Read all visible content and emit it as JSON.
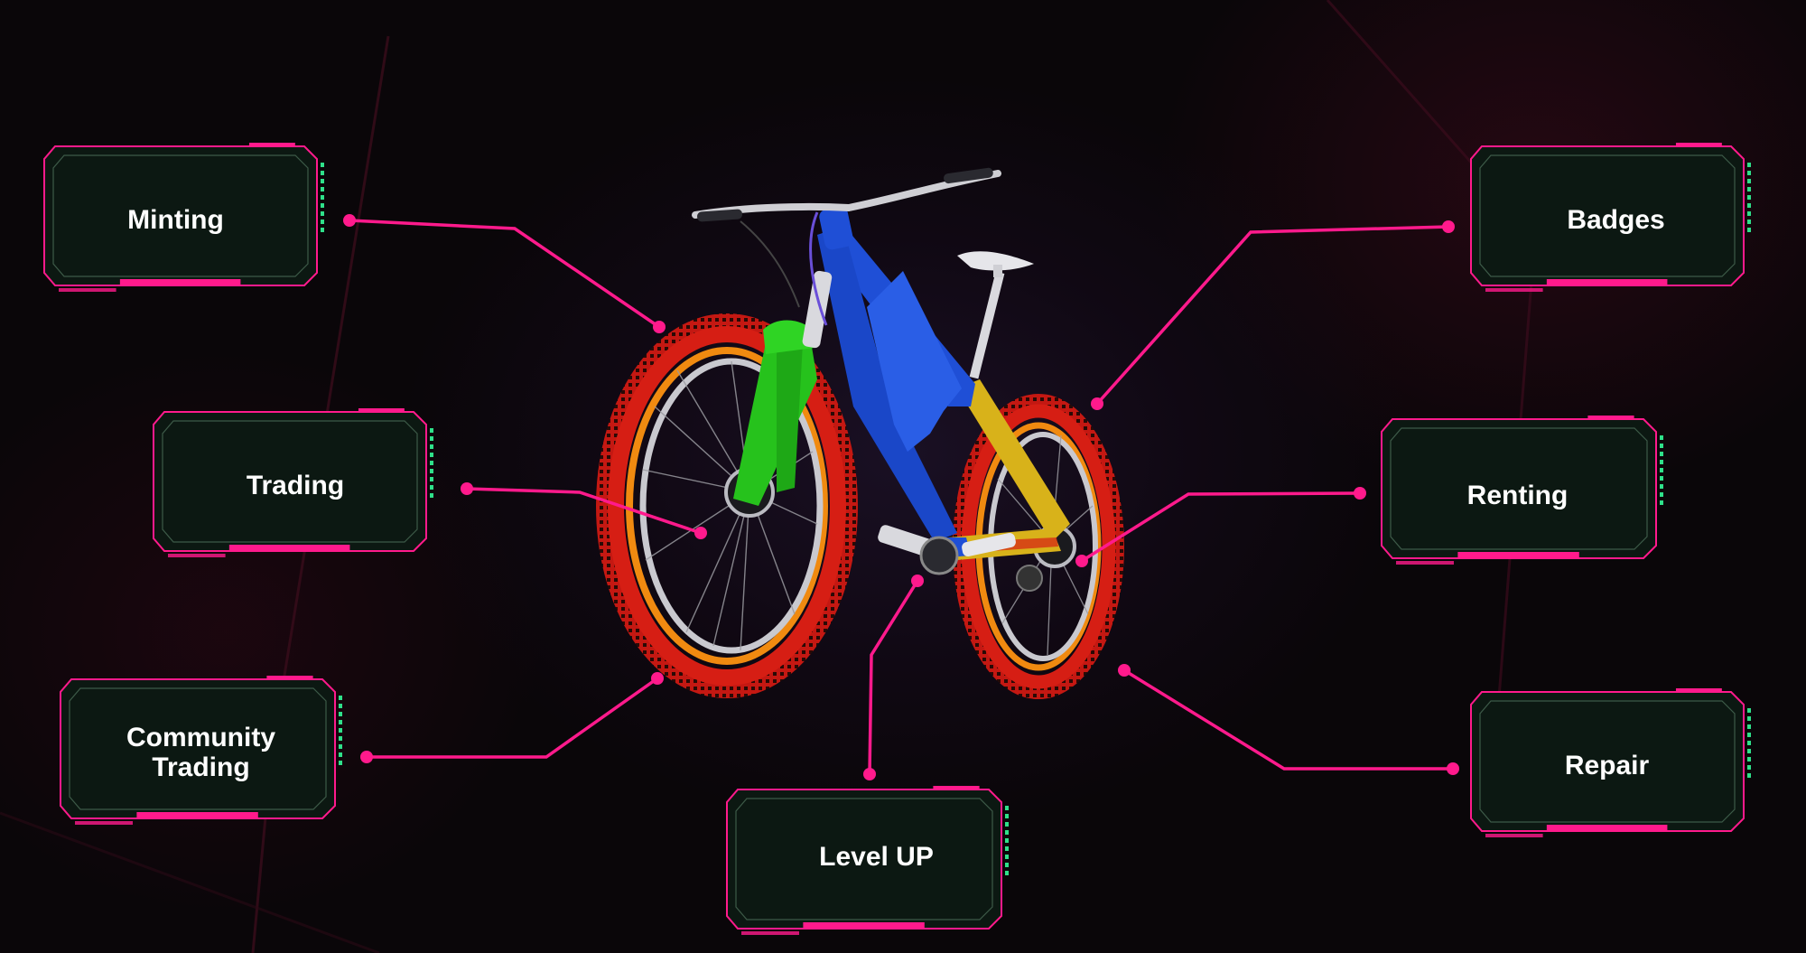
{
  "colors": {
    "connector": "#ff1a8c",
    "card_fill": "#0c1812",
    "card_border": "#ff1a8c",
    "card_accent": "#2fe08a",
    "label": "#ffffff",
    "frame_blue": "#1f4fd6",
    "fork_green": "#26c21c",
    "swingarm_yellow": "#d8b21a",
    "tire_red": "#d61e14",
    "tire_orange": "#f08a10"
  },
  "center_image": {
    "subject": "mountain-bike-icon"
  },
  "nodes": [
    {
      "id": "minting",
      "label": "Minting"
    },
    {
      "id": "trading",
      "label": "Trading"
    },
    {
      "id": "community-trading",
      "label": "Community\nTrading"
    },
    {
      "id": "level-up",
      "label": "Level UP"
    },
    {
      "id": "badges",
      "label": "Badges"
    },
    {
      "id": "renting",
      "label": "Renting"
    },
    {
      "id": "repair",
      "label": "Repair"
    }
  ]
}
